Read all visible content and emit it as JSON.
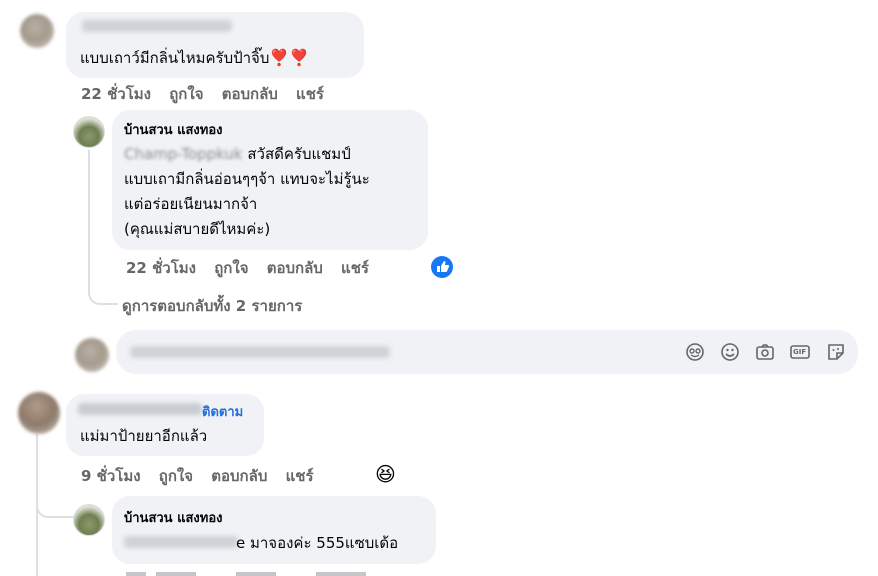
{
  "comment1": {
    "text": "แบบเถาว์มีกลิ่นไหมครับป้าจิ๊บ",
    "emoji": "❣️❣️",
    "actions": {
      "time": "22 ชั่วโมง",
      "like": "ถูกใจ",
      "reply": "ตอบกลับ",
      "share": "แชร์"
    }
  },
  "reply1": {
    "author": "บ้านสวน แสงทอง",
    "mention_visible": "Champ-Toppkuk",
    "lines": [
      "สวัสดีครับแชมป์",
      "แบบเถามีกลิ่นอ่อนๆๆจ้า แทบจะไม่รู้นะ",
      "แต่อร่อยเนียนมากจ้า",
      "(คุณแม่สบายดีไหมค่ะ)"
    ],
    "actions": {
      "time": "22 ชั่วโมง",
      "like": "ถูกใจ",
      "reply": "ตอบกลับ",
      "share": "แชร์"
    },
    "reaction_icon": "like-reaction-icon"
  },
  "view_replies": "ดูการตอบกลับทั้ง 2 รายการ",
  "composer": {
    "icons": [
      "sticker-face-icon",
      "emoji-icon",
      "camera-icon",
      "gif-icon",
      "sticker-icon"
    ],
    "gif_label": "GIF"
  },
  "comment2": {
    "follow": "ติดตาม",
    "text": "แม่มาป้ายยาอีกแล้ว",
    "actions": {
      "time": "9 ชั่วโมง",
      "like": "ถูกใจ",
      "reply": "ตอบกลับ",
      "share": "แชร์"
    },
    "reaction_emoji": "😆"
  },
  "reply2": {
    "author": "บ้านสวน แสงทอง",
    "text_suffix": "e มาจองค่ะ 555แซบเด้อ"
  },
  "colors": {
    "bubble": "#f0f2f5",
    "meta": "#65676b",
    "link": "#216fdb",
    "like": "#1877f2"
  }
}
